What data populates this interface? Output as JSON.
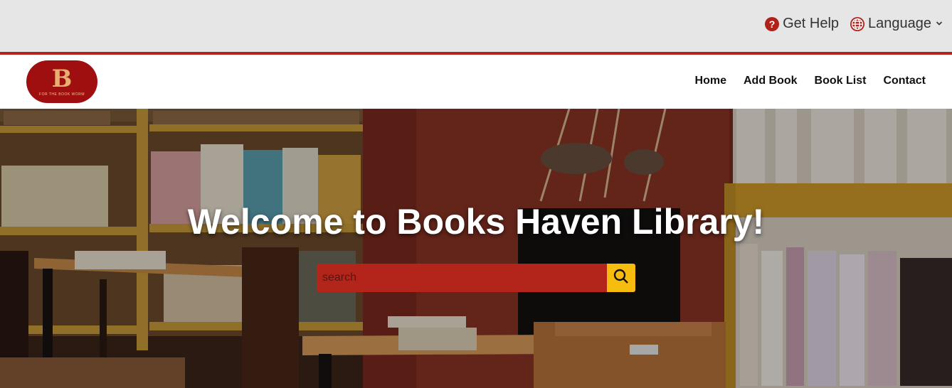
{
  "topbar": {
    "help_label": "Get Help",
    "language_label": "Language"
  },
  "brand": {
    "logo_letter": "B",
    "logo_tagline": "FOR THE BOOK WORM"
  },
  "nav": {
    "items": [
      {
        "label": "Home"
      },
      {
        "label": "Add Book"
      },
      {
        "label": "Book List"
      },
      {
        "label": "Contact"
      }
    ]
  },
  "hero": {
    "title": "Welcome to Books Haven Library!",
    "search_placeholder": "search"
  },
  "colors": {
    "brand_red": "#b5241b",
    "search_button": "#f7bd0e",
    "topbar_bg": "#e6e6e6"
  }
}
